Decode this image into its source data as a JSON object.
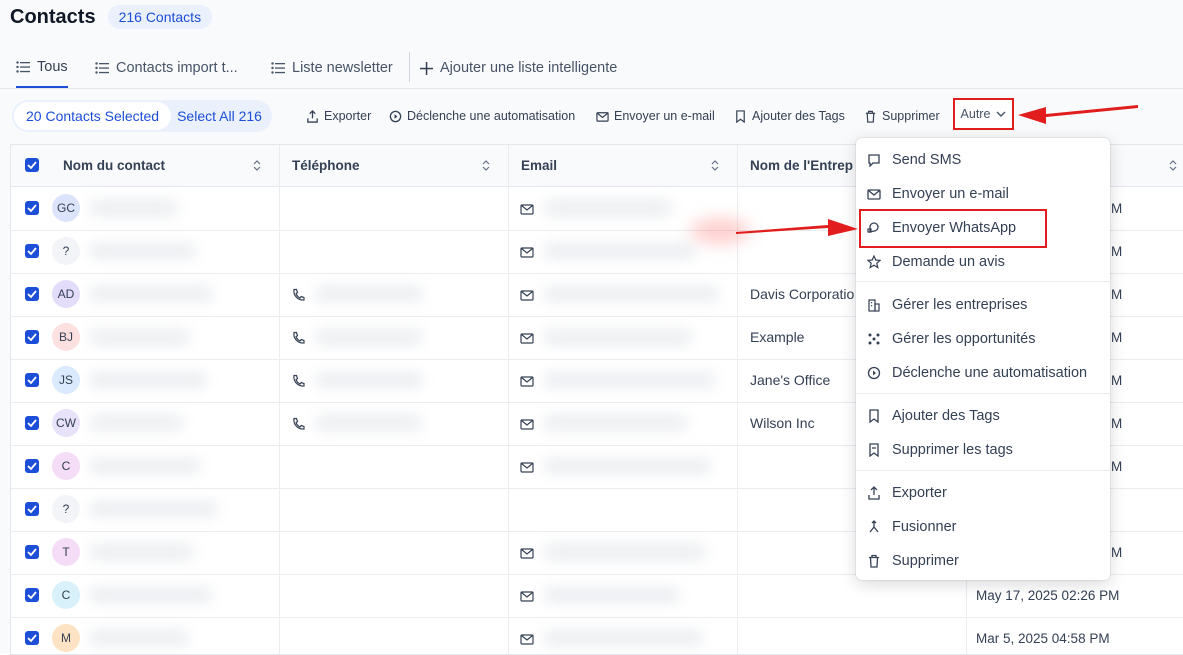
{
  "header": {
    "title": "Contacts",
    "count_badge": "216 Contacts"
  },
  "tabs": [
    {
      "label": "Tous",
      "icon": "list-icon"
    },
    {
      "label": "Contacts import t...",
      "icon": "list-icon"
    },
    {
      "label": "Liste newsletter",
      "icon": "list-icon"
    },
    {
      "label": "Ajouter une liste intelligente",
      "icon": "plus-icon"
    }
  ],
  "toolbar": {
    "selected_label": "20 Contacts Selected",
    "select_all_label": "Select All 216",
    "export_label": "Exporter",
    "automation_label": "Déclenche une automatisation",
    "email_label": "Envoyer un e-mail",
    "tags_label": "Ajouter des Tags",
    "delete_label": "Supprimer",
    "more_label": "Autre"
  },
  "table": {
    "columns": [
      "Nom du contact",
      "Téléphone",
      "Email",
      "Nom de l'Entrep"
    ],
    "rows": [
      {
        "initials": "GC",
        "avatar_color": "#dbe4fb",
        "company": "",
        "date": "M",
        "phone": false,
        "email": true
      },
      {
        "initials": "?",
        "avatar_color": "#f2f4f7",
        "company": "",
        "date": "M",
        "phone": false,
        "email": true
      },
      {
        "initials": "AD",
        "avatar_color": "#e4dcfb",
        "company": "Davis Corporatio",
        "date": "M",
        "phone": true,
        "email": true
      },
      {
        "initials": "BJ",
        "avatar_color": "#fde0e0",
        "company": "Example",
        "date": "M",
        "phone": true,
        "email": true
      },
      {
        "initials": "JS",
        "avatar_color": "#dbeafe",
        "company": "Jane's Office",
        "date": "M",
        "phone": true,
        "email": true
      },
      {
        "initials": "CW",
        "avatar_color": "#e8e2fb",
        "company": "Wilson Inc",
        "date": "M",
        "phone": true,
        "email": true
      },
      {
        "initials": "C",
        "avatar_color": "#f5dcf7",
        "company": "",
        "date": "M",
        "phone": false,
        "email": true
      },
      {
        "initials": "?",
        "avatar_color": "#f2f4f7",
        "company": "",
        "date": "",
        "phone": false,
        "email": false
      },
      {
        "initials": "T",
        "avatar_color": "#f5dcf7",
        "company": "",
        "date": "M",
        "phone": false,
        "email": true
      },
      {
        "initials": "C",
        "avatar_color": "#d8f1fb",
        "company": "",
        "date": "May 17, 2025 02:26 PM",
        "phone": false,
        "email": true
      },
      {
        "initials": "M",
        "avatar_color": "#fde3c4",
        "company": "",
        "date": "Mar 5, 2025 04:58 PM",
        "phone": false,
        "email": true
      }
    ]
  },
  "menu": {
    "items": [
      {
        "label": "Send SMS",
        "icon": "chat-bubble-icon"
      },
      {
        "label": "Envoyer un e-mail",
        "icon": "mail-icon"
      },
      {
        "label": "Envoyer WhatsApp",
        "icon": "whatsapp-icon"
      },
      {
        "label": "Demande un avis",
        "icon": "star-icon"
      },
      {
        "label": "Gérer les entreprises",
        "icon": "building-icon"
      },
      {
        "label": "Gérer les opportunités",
        "icon": "pipeline-icon"
      },
      {
        "label": "Déclenche une automatisation",
        "icon": "automation-icon"
      },
      {
        "label": "Ajouter des Tags",
        "icon": "tag-icon"
      },
      {
        "label": "Supprimer les tags",
        "icon": "tag-remove-icon"
      },
      {
        "label": "Exporter",
        "icon": "upload-icon"
      },
      {
        "label": "Fusionner",
        "icon": "merge-icon"
      },
      {
        "label": "Supprimer",
        "icon": "trash-icon"
      }
    ]
  },
  "colors": {
    "accent": "#1d4ed8",
    "highlight": "#e11d1d",
    "text": "#344054"
  }
}
